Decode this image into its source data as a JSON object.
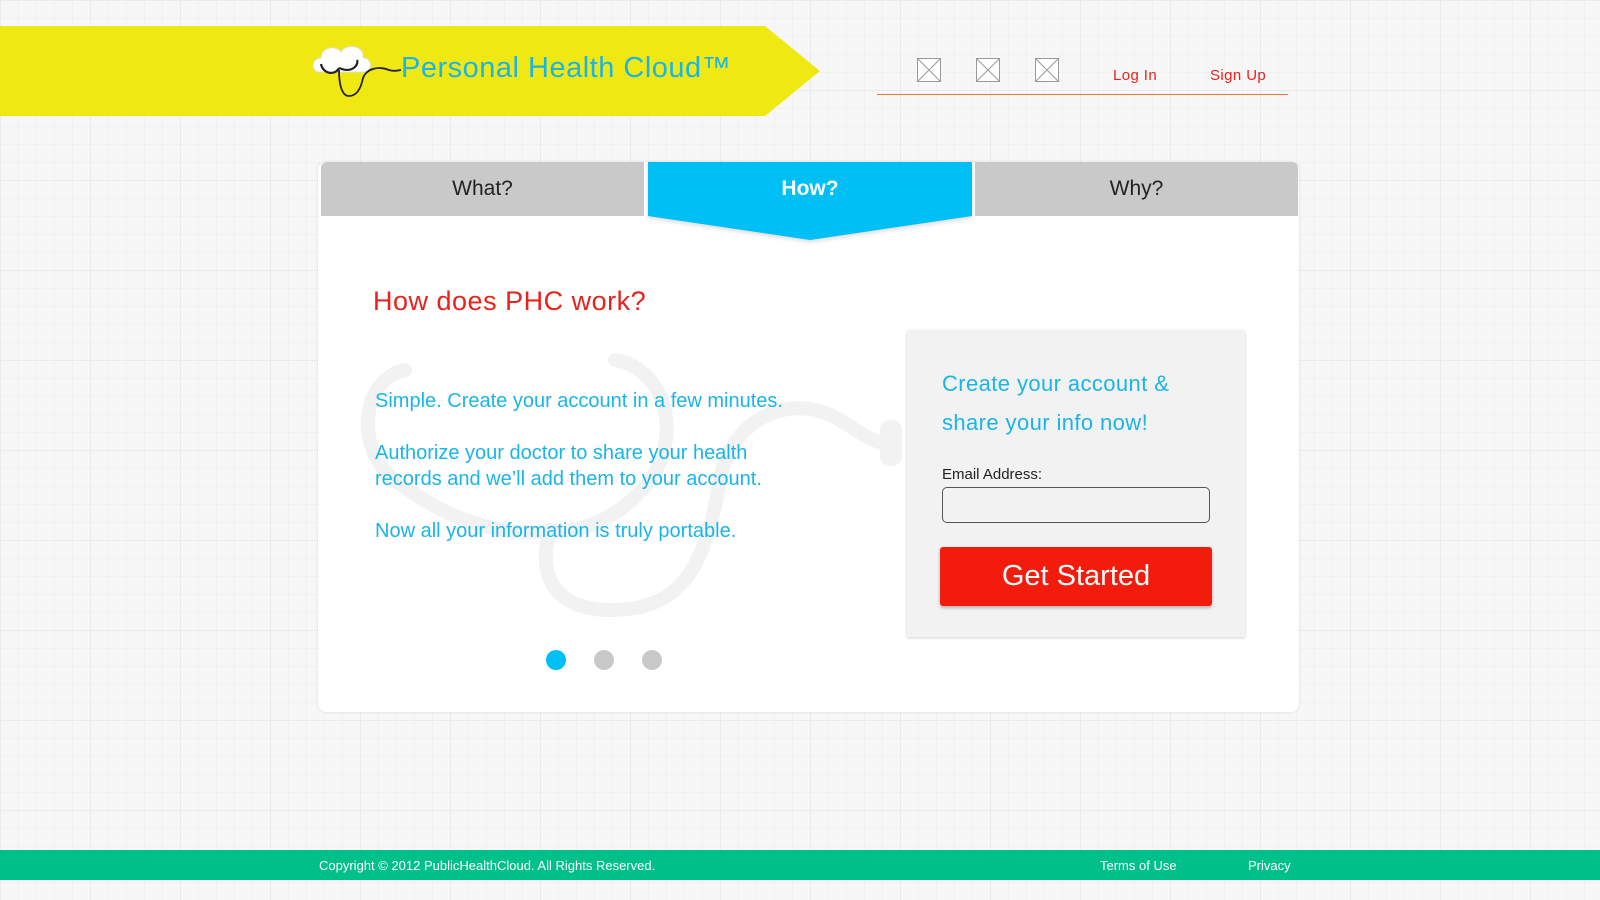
{
  "header": {
    "brand": "Personal Health Cloud™",
    "social_icons": [
      "placeholder-image-icon",
      "placeholder-image-icon",
      "placeholder-image-icon"
    ],
    "login_label": "Log In",
    "signup_label": "Sign Up"
  },
  "tabs": [
    {
      "label": "What?",
      "active": false
    },
    {
      "label": "How?",
      "active": true
    },
    {
      "label": "Why?",
      "active": false
    }
  ],
  "main": {
    "headline": "How does PHC work?",
    "paragraphs": [
      "Simple. Create your account in a few minutes.",
      "Authorize your doctor to share your health records and we’ll add them to your account.",
      "Now all your information is truly portable."
    ],
    "carousel": {
      "count": 3,
      "active_index": 0
    }
  },
  "signup_box": {
    "title": "Create your account & share your info now!",
    "email_label": "Email Address:",
    "email_value": "",
    "button_label": "Get Started"
  },
  "footer": {
    "copyright": "Copyright © 2012 PublicHealthCloud. All Rights Reserved.",
    "terms_label": "Terms of Use",
    "privacy_label": "Privacy"
  },
  "colors": {
    "banner": "#f0e813",
    "brand_blue": "#1ab5e8",
    "active_tab": "#00bff5",
    "red": "#e8221c",
    "button": "#f31c0c",
    "footer": "#00c08a"
  }
}
